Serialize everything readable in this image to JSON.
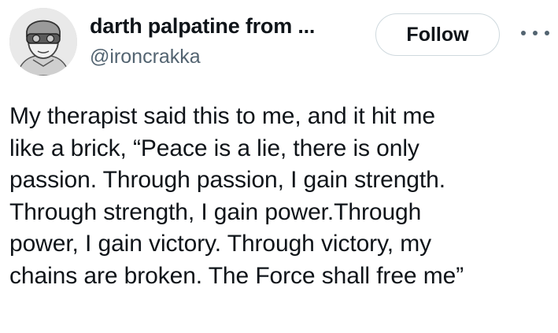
{
  "user": {
    "display_name": "darth palpatine from ...",
    "handle": "@ironcrakka"
  },
  "actions": {
    "follow_label": "Follow",
    "more_icon": "more-horizontal-icon"
  },
  "tweet": {
    "lines": [
      "My therapist said this to me, and it hit me",
      "like a brick, “Peace is a lie, there is only",
      "passion. Through passion, I gain strength.",
      "Through strength, I gain power.Through",
      "power, I gain victory. Through victory, my",
      "chains are broken. The Force shall free me”"
    ]
  },
  "colors": {
    "text": "#0f1419",
    "secondary": "#536471",
    "button_border": "#cfd9de"
  }
}
